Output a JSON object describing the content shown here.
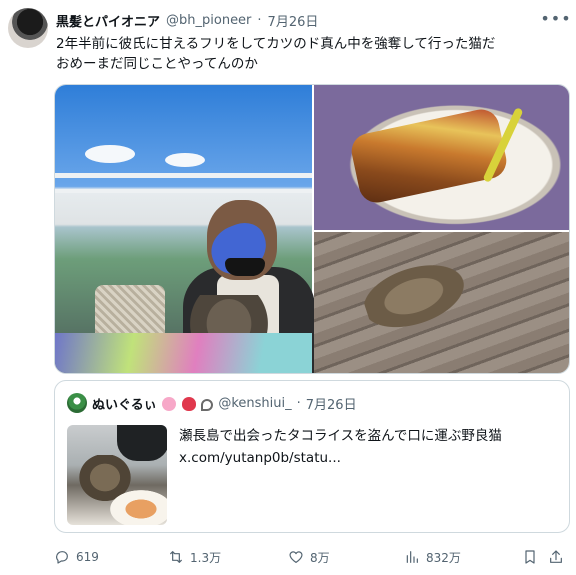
{
  "tweet": {
    "author_name": "黒髪とパイオニア",
    "handle": "@bh_pioneer",
    "separator": "·",
    "date": "7月26日",
    "more_icon": "more-horizontal-icon",
    "text_line1": "2年半前に彼氏に甘えるフリをしてカツのド真ん中を強奪して行った猫だ",
    "text_line2": "おめーまだ同じことやってんのか"
  },
  "quote": {
    "author_name": "ぬいぐるぃ",
    "handle": "@kenshiui_",
    "separator": "·",
    "date": "7月26日",
    "text": "瀬長島で出会ったタコライスを盗んで口に運ぶ野良猫",
    "link": "x.com/yutanp0b/statu..."
  },
  "actions": {
    "reply_count": "619",
    "retweet_count": "1.3万",
    "like_count": "8万",
    "view_count": "832万"
  },
  "colors": {
    "text": "#0f1419",
    "secondary": "#536471",
    "border": "#cfd9de"
  }
}
